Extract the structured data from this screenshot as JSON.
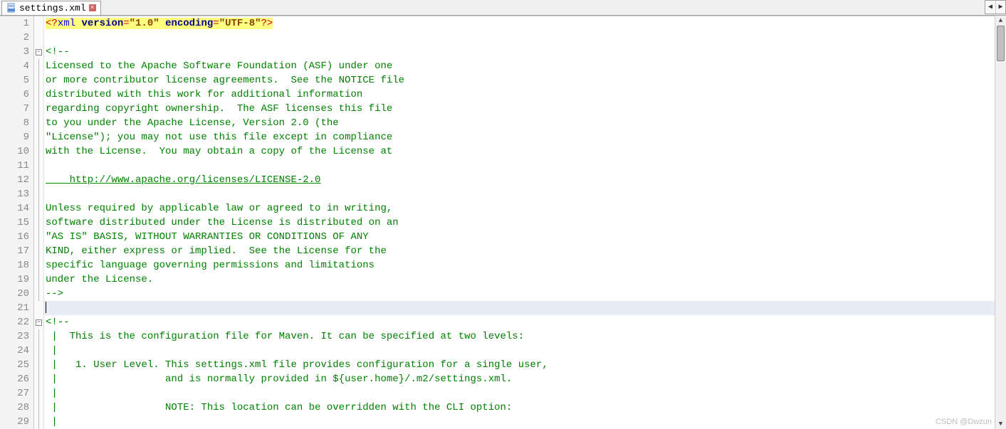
{
  "tab": {
    "filename": "settings.xml"
  },
  "xml_decl": {
    "open": "<?",
    "tag": "xml",
    "attr1_name": "version",
    "attr1_val": "\"1.0\"",
    "attr2_name": "encoding",
    "attr2_val": "\"UTF-8\"",
    "close": "?>"
  },
  "lines": {
    "l3": "<!--",
    "l4": "Licensed to the Apache Software Foundation (ASF) under one",
    "l5": "or more contributor license agreements.  See the NOTICE file",
    "l6": "distributed with this work for additional information",
    "l7": "regarding copyright ownership.  The ASF licenses this file",
    "l8": "to you under the Apache License, Version 2.0 (the",
    "l9": "\"License\"); you may not use this file except in compliance",
    "l10": "with the License.  You may obtain a copy of the License at",
    "l12": "    http://www.apache.org/licenses/LICENSE-2.0",
    "l14": "Unless required by applicable law or agreed to in writing,",
    "l15": "software distributed under the License is distributed on an",
    "l16": "\"AS IS\" BASIS, WITHOUT WARRANTIES OR CONDITIONS OF ANY",
    "l17": "KIND, either express or implied.  See the License for the",
    "l18": "specific language governing permissions and limitations",
    "l19": "under the License.",
    "l20": "-->",
    "l22": "<!--",
    "l23": " |  This is the configuration file for Maven. It can be specified at two levels:",
    "l24": " |",
    "l25": " |   1. User Level. This settings.xml file provides configuration for a single user,",
    "l26": " |                  and is normally provided in ${user.home}/.m2/settings.xml.",
    "l27": " |",
    "l28": " |                  NOTE: This location can be overridden with the CLI option:",
    "l29": " |"
  },
  "line_numbers": [
    "1",
    "2",
    "3",
    "4",
    "5",
    "6",
    "7",
    "8",
    "9",
    "10",
    "11",
    "12",
    "13",
    "14",
    "15",
    "16",
    "17",
    "18",
    "19",
    "20",
    "21",
    "22",
    "23",
    "24",
    "25",
    "26",
    "27",
    "28",
    "29"
  ],
  "watermark": "CSDN @Dwzun"
}
